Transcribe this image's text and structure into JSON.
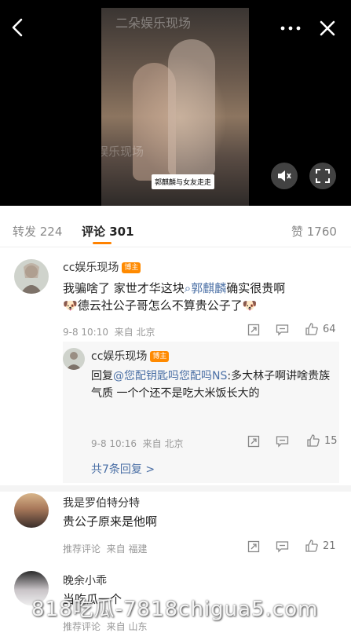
{
  "video": {
    "watermark_top": "二朵娱乐现场",
    "watermark_mid": "娱乐现场",
    "caption": "郭麒麟与女友走走"
  },
  "tabs": {
    "repost": "转发 224",
    "comment": "评论 301",
    "like": "赞 1760"
  },
  "comments": [
    {
      "name": "cc娱乐现场",
      "badge": "博主",
      "text_a": "我骗啥了 家世才华这块",
      "text_link": "郭麒麟",
      "text_b": "确实很贵啊",
      "text_c": "德云社公子哥怎么不算贵公子了",
      "time": "9-8 10:10",
      "location": "来自 北京",
      "likes": "64"
    },
    {
      "name": "我是罗伯特分特",
      "text": "贵公子原来是他啊",
      "time": "推荐评论",
      "location": "来自 福建",
      "likes": "21"
    },
    {
      "name": "晚余小乖",
      "text": "当吃瓜一个",
      "time": "推荐评论",
      "location": "来自 山东"
    }
  ],
  "reply": {
    "name": "cc娱乐现场",
    "badge": "博主",
    "prefix": "回复",
    "mention": "@您配钥匙吗您配吗NS",
    "text": ":多大林子啊讲啥贵族气质 一个个还不是吃大米饭长大的",
    "time": "9-8 10:16",
    "location": "来自 北京",
    "likes": "15",
    "more": "共7条回复 >"
  },
  "watermark": "818吃瓜-7818chigua5.com",
  "icons": [
    "back-icon",
    "more-icon",
    "close-icon",
    "mute-icon",
    "fullscreen-icon",
    "search-icon",
    "share-icon",
    "comment-icon",
    "like-icon"
  ]
}
